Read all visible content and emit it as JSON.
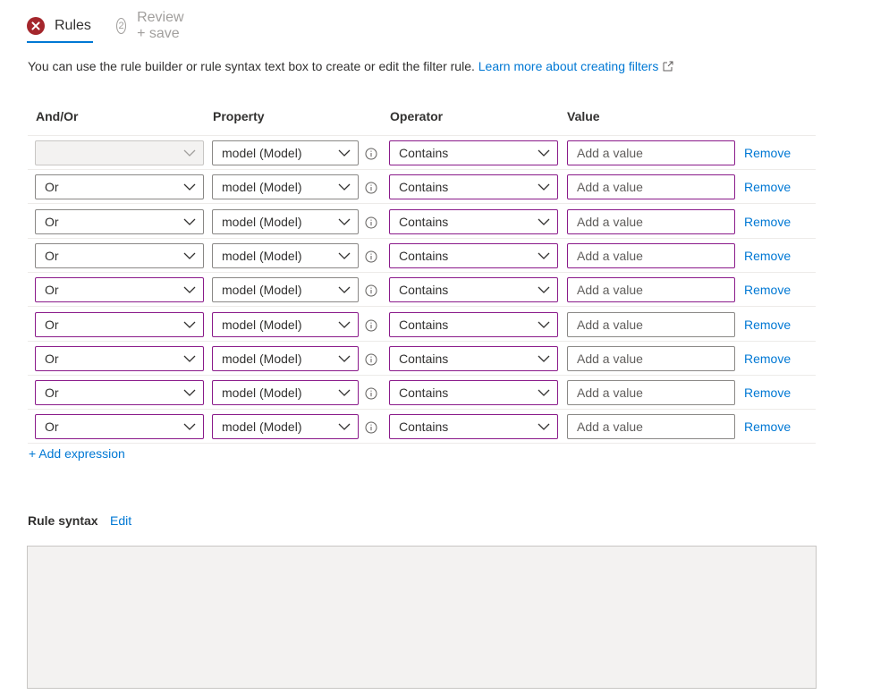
{
  "tabs": {
    "rules": "Rules",
    "review_step": "2",
    "review": "Review + save"
  },
  "description": {
    "text": "You can use the rule builder or rule syntax text box to create or edit the filter rule.",
    "link": "Learn more about creating filters"
  },
  "table": {
    "headers": {
      "andor": "And/Or",
      "property": "Property",
      "operator": "Operator",
      "value": "Value"
    },
    "rows": [
      {
        "andor": "",
        "property": "model (Model)",
        "operator": "Contains",
        "value_placeholder": "Add a value",
        "remove": "Remove"
      },
      {
        "andor": "Or",
        "property": "model (Model)",
        "operator": "Contains",
        "value_placeholder": "Add a value",
        "remove": "Remove"
      },
      {
        "andor": "Or",
        "property": "model (Model)",
        "operator": "Contains",
        "value_placeholder": "Add a value",
        "remove": "Remove"
      },
      {
        "andor": "Or",
        "property": "model (Model)",
        "operator": "Contains",
        "value_placeholder": "Add a value",
        "remove": "Remove"
      },
      {
        "andor": "Or",
        "property": "model (Model)",
        "operator": "Contains",
        "value_placeholder": "Add a value",
        "remove": "Remove"
      },
      {
        "andor": "Or",
        "property": "model (Model)",
        "operator": "Contains",
        "value_placeholder": "Add a value",
        "remove": "Remove"
      },
      {
        "andor": "Or",
        "property": "model (Model)",
        "operator": "Contains",
        "value_placeholder": "Add a value",
        "remove": "Remove"
      },
      {
        "andor": "Or",
        "property": "model (Model)",
        "operator": "Contains",
        "value_placeholder": "Add a value",
        "remove": "Remove"
      },
      {
        "andor": "Or",
        "property": "model (Model)",
        "operator": "Contains",
        "value_placeholder": "Add a value",
        "remove": "Remove"
      }
    ]
  },
  "add_expression": "+ Add expression",
  "rule_syntax": {
    "title": "Rule syntax",
    "edit": "Edit",
    "value": ""
  },
  "colors": {
    "accent": "#0078d4",
    "error": "#a4262c",
    "invalid_border": "#8a1a8a"
  }
}
